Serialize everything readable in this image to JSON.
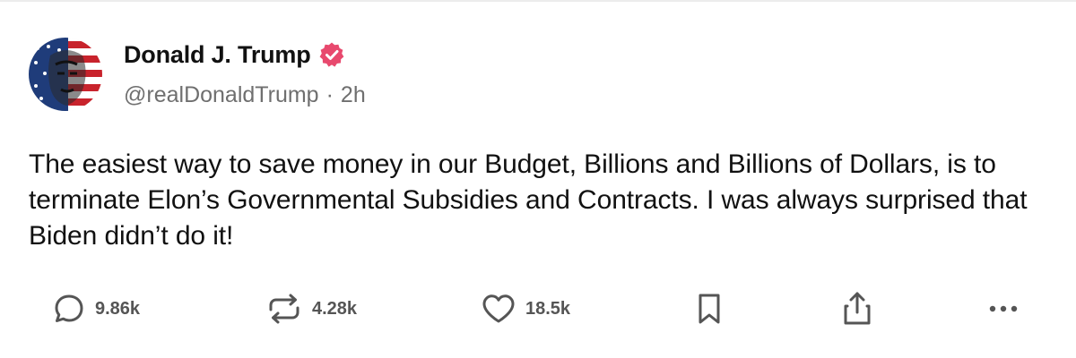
{
  "post": {
    "author": {
      "display_name": "Donald J. Trump",
      "handle": "@realDonaldTrump",
      "separator": "·",
      "time_ago": "2h",
      "verified": true
    },
    "text": "The easiest way to save money in our Budget, Billions and Billions of Dollars, is to terminate Elon’s Governmental Subsidies and Contracts. I was always surprised that Biden didn’t do it!",
    "actions": {
      "replies": "9.86k",
      "reposts": "4.28k",
      "likes": "18.5k"
    },
    "icons": [
      "comment-icon",
      "repost-icon",
      "heart-icon",
      "bookmark-icon",
      "share-icon",
      "more-icon",
      "verified-badge-icon"
    ]
  },
  "colors": {
    "verified_badge": "#e8496e",
    "icon_gray": "#555555",
    "meta_gray": "#6f6f6f",
    "text": "#111111"
  }
}
